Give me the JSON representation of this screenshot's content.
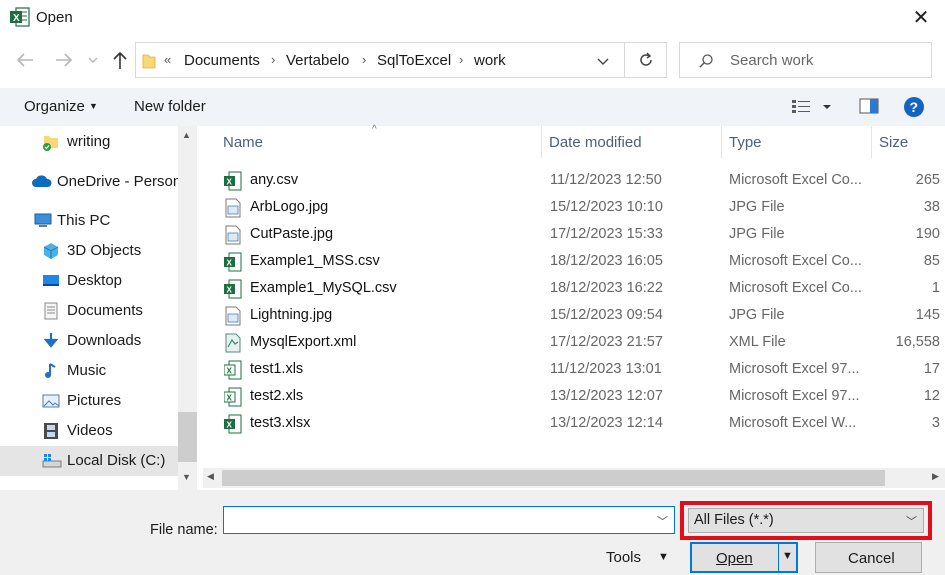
{
  "window": {
    "title": "Open",
    "close_symbol": "✕"
  },
  "nav": {
    "back_icon": "arrow-left-icon",
    "forward_icon": "arrow-right-icon",
    "recent_icon": "chevron-down-icon",
    "up_icon": "arrow-up-icon",
    "address_overflow": "«",
    "breadcrumbs": [
      "Documents",
      "Vertabelo",
      "SqlToExcel",
      "work"
    ],
    "search_placeholder": "Search work"
  },
  "toolbar": {
    "organize_label": "Organize",
    "new_folder_label": "New folder"
  },
  "sidebar": {
    "items": [
      {
        "label": "writing",
        "icon": "folder-synced-icon"
      },
      {
        "label": "OneDrive - Person",
        "icon": "cloud-icon"
      },
      {
        "label": "This PC",
        "icon": "computer-icon"
      },
      {
        "label": "3D Objects",
        "icon": "cube-icon"
      },
      {
        "label": "Desktop",
        "icon": "desktop-icon"
      },
      {
        "label": "Documents",
        "icon": "document-icon"
      },
      {
        "label": "Downloads",
        "icon": "download-icon"
      },
      {
        "label": "Music",
        "icon": "music-note-icon"
      },
      {
        "label": "Pictures",
        "icon": "picture-icon"
      },
      {
        "label": "Videos",
        "icon": "film-icon"
      },
      {
        "label": "Local Disk (C:)",
        "icon": "drive-icon"
      }
    ]
  },
  "columns": {
    "name": "Name",
    "date": "Date modified",
    "type": "Type",
    "size": "Size"
  },
  "files": [
    {
      "name": "any.csv",
      "date": "11/12/2023 12:50",
      "type": "Microsoft Excel Co...",
      "size": "265",
      "icon": "excel-csv-icon"
    },
    {
      "name": "ArbLogo.jpg",
      "date": "15/12/2023 10:10",
      "type": "JPG File",
      "size": "38",
      "icon": "image-file-icon"
    },
    {
      "name": "CutPaste.jpg",
      "date": "17/12/2023 15:33",
      "type": "JPG File",
      "size": "190",
      "icon": "image-file-icon"
    },
    {
      "name": "Example1_MSS.csv",
      "date": "18/12/2023 16:05",
      "type": "Microsoft Excel Co...",
      "size": "85",
      "icon": "excel-csv-icon"
    },
    {
      "name": "Example1_MySQL.csv",
      "date": "18/12/2023 16:22",
      "type": "Microsoft Excel Co...",
      "size": "1",
      "icon": "excel-csv-icon"
    },
    {
      "name": "Lightning.jpg",
      "date": "15/12/2023 09:54",
      "type": "JPG File",
      "size": "145",
      "icon": "image-file-icon"
    },
    {
      "name": "MysqlExport.xml",
      "date": "17/12/2023 21:57",
      "type": "XML File",
      "size": "16,558",
      "icon": "xml-file-icon"
    },
    {
      "name": "test1.xls",
      "date": "11/12/2023 13:01",
      "type": "Microsoft Excel 97...",
      "size": "17",
      "icon": "excel-xls-icon"
    },
    {
      "name": "test2.xls",
      "date": "13/12/2023 12:07",
      "type": "Microsoft Excel 97...",
      "size": "12",
      "icon": "excel-xls-icon"
    },
    {
      "name": "test3.xlsx",
      "date": "13/12/2023 12:14",
      "type": "Microsoft Excel W...",
      "size": "3",
      "icon": "excel-xlsx-icon"
    }
  ],
  "footer": {
    "file_name_label": "File name:",
    "file_name_value": "",
    "file_type_value": "All Files (*.*)",
    "tools_label": "Tools",
    "open_label": "Open",
    "cancel_label": "Cancel"
  },
  "colors": {
    "accent": "#0078d7",
    "highlight_box": "#e00f1c",
    "excel_green": "#1d6f42",
    "folder_yellow": "#f8d775"
  }
}
